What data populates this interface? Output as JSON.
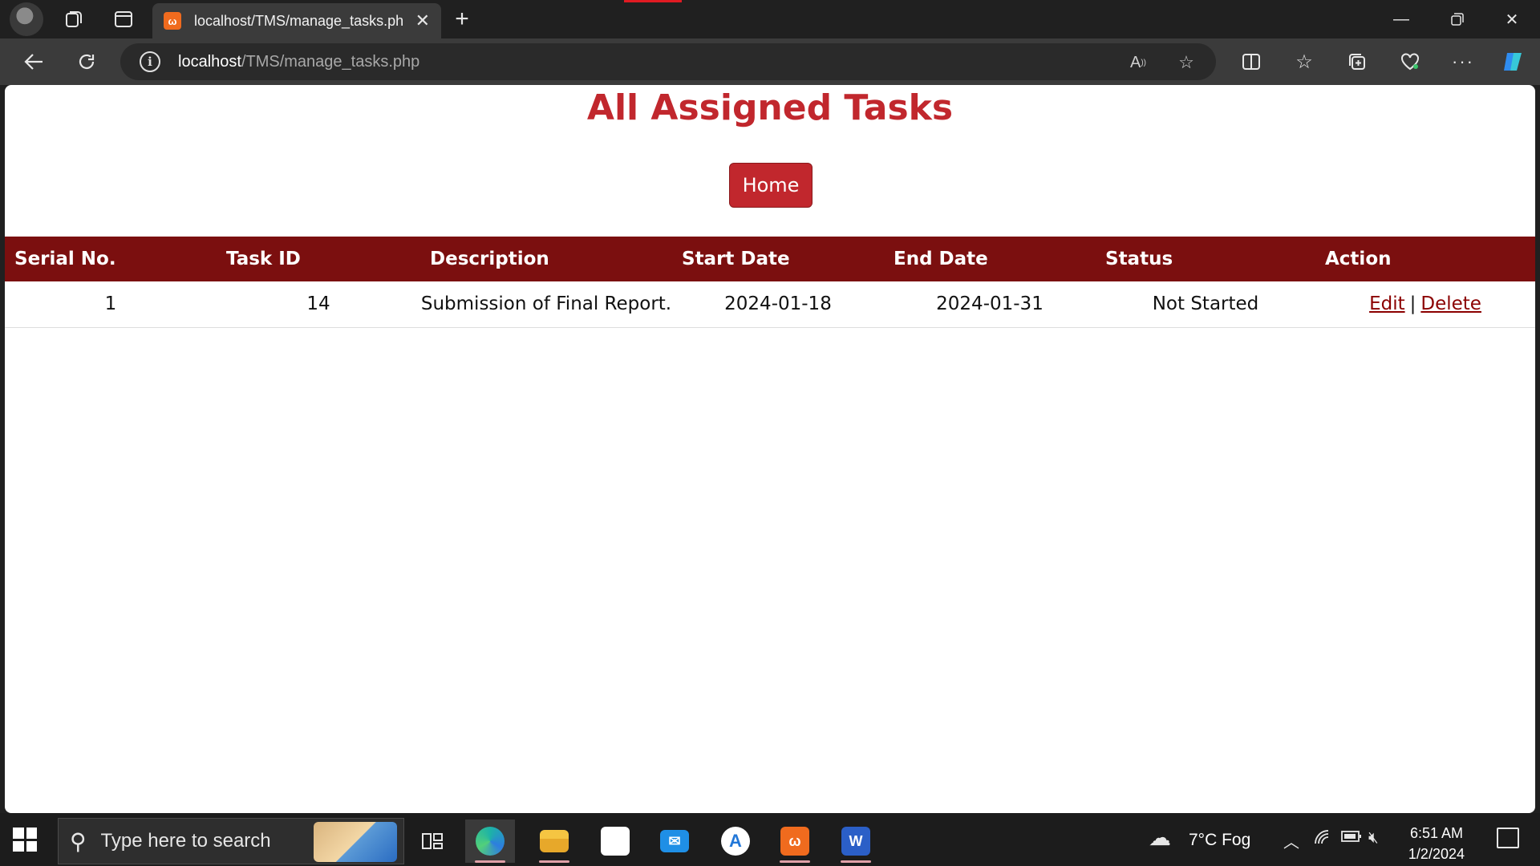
{
  "browser": {
    "tab_title": "localhost/TMS/manage_tasks.php",
    "tab_favicon": "xampp-icon",
    "url_host": "localhost",
    "url_path": "/TMS/manage_tasks.php"
  },
  "page": {
    "title": "All Assigned Tasks",
    "home_button": "Home",
    "title_color": "#c1272d",
    "header_color": "#7b0f0f"
  },
  "table": {
    "headers": [
      "Serial No.",
      "Task ID",
      "Description",
      "Start Date",
      "End Date",
      "Status",
      "Action"
    ],
    "rows": [
      {
        "serial": "1",
        "task_id": "14",
        "description": "Submission of Final Report.",
        "start_date": "2024-01-18",
        "end_date": "2024-01-31",
        "status": "Not Started",
        "edit_label": "Edit",
        "separator": "|",
        "delete_label": "Delete"
      }
    ]
  },
  "taskbar": {
    "search_placeholder": "Type here to search",
    "weather": "7°C  Fog",
    "time": "6:51 AM",
    "date": "1/2/2024"
  }
}
